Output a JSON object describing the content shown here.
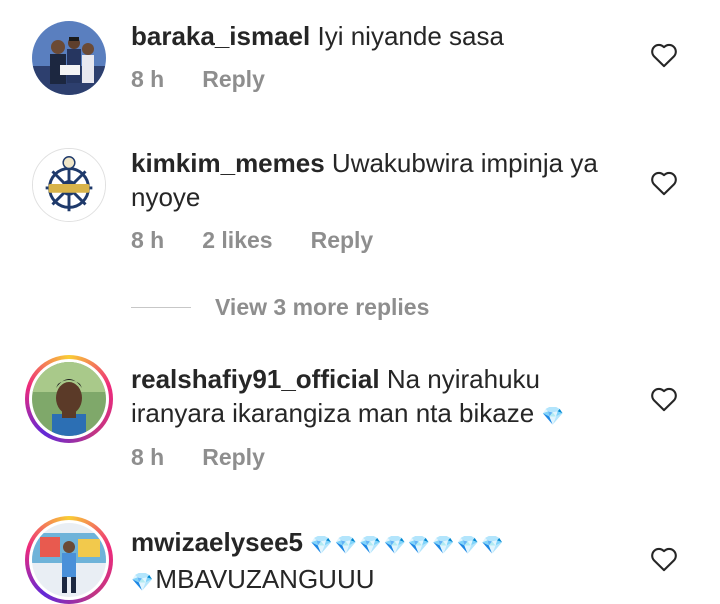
{
  "comments": [
    {
      "username": "baraka_ismael",
      "text": "Iyi niyande sasa",
      "time": "8 h",
      "likes": "",
      "reply": "Reply"
    },
    {
      "username": "kimkim_memes",
      "text": "Uwakubwira impinja ya nyoye",
      "time": "8 h",
      "likes": "2 likes",
      "reply": "Reply"
    },
    {
      "username": "realshafiy91_official",
      "text": "Na nyirahuku iranyara ikarangiza man nta bikaze",
      "text_emoji": "💎",
      "time": "8 h",
      "likes": "",
      "reply": "Reply"
    },
    {
      "username": "mwizaelysee5",
      "text_emoji": "💎💎💎💎💎💎💎💎",
      "text_emoji_2": "💎",
      "text": "MBAVUZANGUUU"
    }
  ],
  "view_more": "View 3 more replies",
  "icons": {
    "heart": "heart-outline-icon"
  }
}
